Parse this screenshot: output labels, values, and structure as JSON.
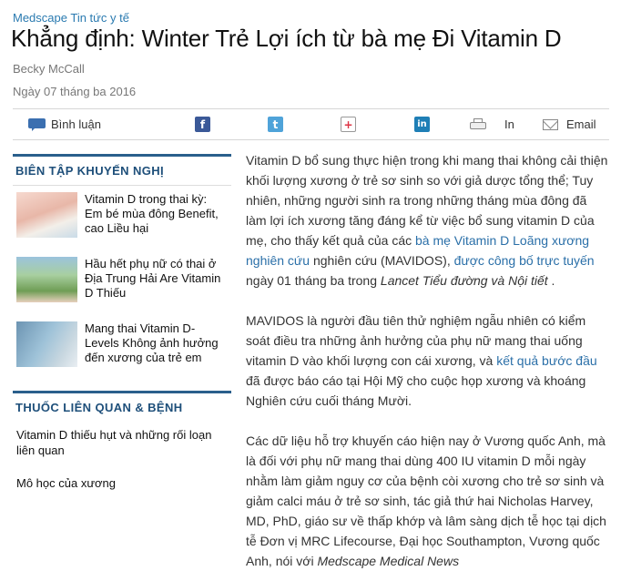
{
  "header": {
    "kicker": "Medscape Tin tức y tế",
    "title": "Khẳng định: Winter Trẻ Lợi ích từ bà mẹ Đi Vitamin D",
    "author": "Becky McCall",
    "date": "Ngày 07 tháng ba 2016"
  },
  "toolbar": {
    "comment_label": "Bình luận",
    "print_label": "In",
    "email_label": "Email"
  },
  "sidebar": {
    "editor_title": "BIÊN TẬP KHUYẾN NGHỊ",
    "recommendations": [
      {
        "title": "Vitamin D trong thai kỳ: Em bé mùa đông Benefit, cao Liều hại"
      },
      {
        "title": "Hầu hết phụ nữ có thai ở Địa Trung Hải Are Vitamin D Thiếu"
      },
      {
        "title": "Mang thai Vitamin D-Levels Không ảnh hưởng đến xương của trẻ em"
      }
    ],
    "related_title": "THUỐC LIÊN QUAN & BỆNH",
    "related": [
      {
        "label": "Vitamin D thiếu hụt và những rối loạn liên quan"
      },
      {
        "label": "Mô học của xương"
      }
    ]
  },
  "article": {
    "p1_a": "Vitamin D bổ sung thực hiện trong khi mang thai không cải thiện khối lượng xương ở trẻ sơ sinh so với giả dược tổng thể; Tuy nhiên, những người sinh ra trong những tháng mùa đông đã làm lợi ích xương tăng đáng kể từ việc bổ sung vitamin D của mẹ, cho thấy kết quả của các ",
    "p1_link1": "bà mẹ Vitamin D Loãng xương nghiên cứu",
    "p1_b": " nghiên cứu (MAVIDOS), ",
    "p1_link2": "được công bố trực tuyến",
    "p1_c": " ngày 01 tháng ba trong ",
    "p1_journal": "Lancet Tiểu đường và Nội tiết",
    "p1_d": " .",
    "p2_a": "MAVIDOS là người đầu tiên thử nghiệm ngẫu nhiên có kiểm soát điều tra những ảnh hưởng của phụ nữ mang thai uống vitamin D vào khối lượng con cái xương, và ",
    "p2_link": "kết quả bước đầu",
    "p2_b": " đã được báo cáo tại Hội Mỹ cho cuộc họp xương và khoáng Nghiên cứu cuối tháng Mười.",
    "p3_a": "Các dữ liệu hỗ trợ khuyến cáo hiện nay ở Vương quốc Anh, mà là đối với phụ nữ mang thai dùng 400 IU vitamin D mỗi ngày nhằm làm giảm nguy cơ của bệnh còi xương cho trẻ sơ sinh và giảm calci máu ở trẻ sơ sinh, tác giả thứ hai Nicholas Harvey, MD, PhD, giáo sư về thấp khớp và lâm sàng dịch tễ học tại dịch tễ Đơn vị MRC Lifecourse, Đại học Southampton, Vương quốc Anh, nói với ",
    "p3_source": "Medscape Medical News"
  }
}
